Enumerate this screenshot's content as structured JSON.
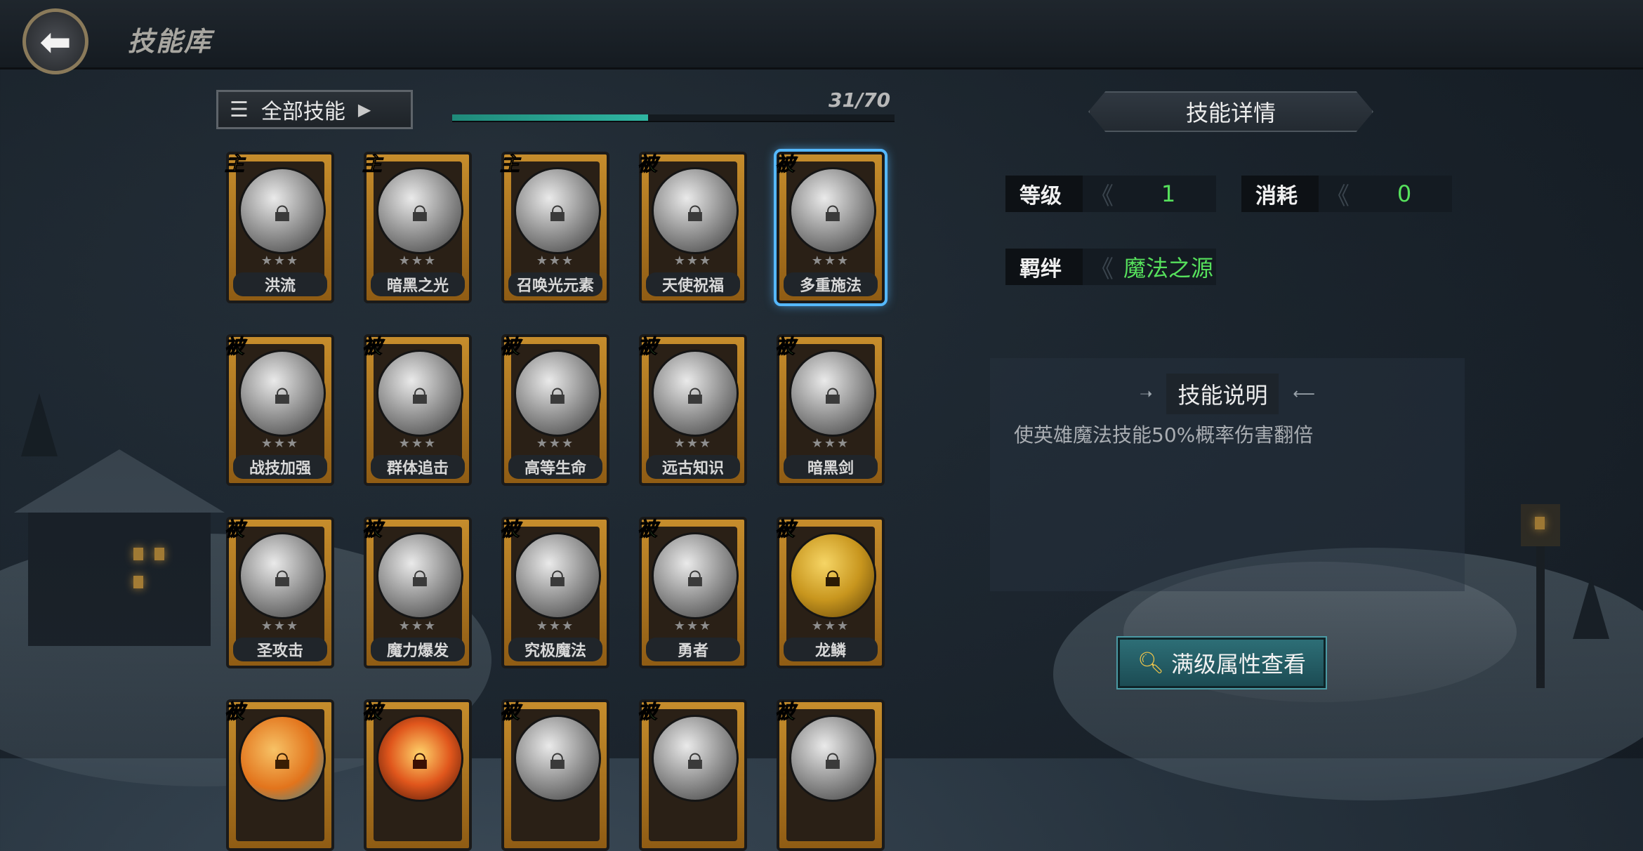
{
  "header": {
    "title": "技能库",
    "back_icon": "back-arrow-icon"
  },
  "filter": {
    "label": "全部技能",
    "progress_text": "31/70",
    "progress_fraction": 0.443
  },
  "skills": [
    {
      "name": "洪流",
      "type": "主",
      "stars": "★★★",
      "icon": "wave-icon"
    },
    {
      "name": "暗黑之光",
      "type": "主",
      "stars": "★★★",
      "icon": "dark-orb-icon"
    },
    {
      "name": "召唤光元素",
      "type": "主",
      "stars": "★★★",
      "icon": "yin-yang-icon"
    },
    {
      "name": "天使祝福",
      "type": "被",
      "stars": "★★★",
      "icon": "rainbow-icon"
    },
    {
      "name": "多重施法",
      "type": "被",
      "stars": "★★★",
      "icon": "hands-icon",
      "selected": true
    },
    {
      "name": "战技加强",
      "type": "被",
      "stars": "★★★",
      "icon": "claw-icon"
    },
    {
      "name": "群体追击",
      "type": "被",
      "stars": "★★★",
      "icon": "tentacle-icon"
    },
    {
      "name": "高等生命",
      "type": "被",
      "stars": "★★★",
      "icon": "chalice-icon"
    },
    {
      "name": "远古知识",
      "type": "被",
      "stars": "★★★",
      "icon": "tome-icon"
    },
    {
      "name": "暗黑剑",
      "type": "被",
      "stars": "★★★",
      "icon": "dark-sword-icon"
    },
    {
      "name": "圣攻击",
      "type": "被",
      "stars": "★★★",
      "icon": "holy-sword-icon"
    },
    {
      "name": "魔力爆发",
      "type": "被",
      "stars": "★★★",
      "icon": "vortex-icon"
    },
    {
      "name": "究极魔法",
      "type": "被",
      "stars": "★★★",
      "icon": "swirl-icon"
    },
    {
      "name": "勇者",
      "type": "被",
      "stars": "★★★",
      "icon": "knight-icon"
    },
    {
      "name": "龙鳞",
      "type": "被",
      "stars": "★★★",
      "icon": "dragon-icon",
      "color": "gold"
    },
    {
      "name": "",
      "type": "被",
      "stars": "",
      "icon": "fruit-icon",
      "color": "orange"
    },
    {
      "name": "",
      "type": "被",
      "stars": "",
      "icon": "fire-book-icon",
      "color": "fire"
    },
    {
      "name": "",
      "type": "被",
      "stars": "",
      "icon": "flask-icon"
    },
    {
      "name": "",
      "type": "被",
      "stars": "",
      "icon": "statue-icon"
    },
    {
      "name": "",
      "type": "被",
      "stars": "",
      "icon": "beast-icon"
    }
  ],
  "detail": {
    "header": "技能详情",
    "level_label": "等级",
    "level_value": "1",
    "cost_label": "消耗",
    "cost_value": "0",
    "bond_label": "羁绊",
    "bond_value": "魔法之源",
    "desc_title": "技能说明",
    "desc_text": "使英雄魔法技能50%概率伤害翻倍",
    "full_button": "满级属性查看"
  },
  "colors": {
    "accent_green": "#56e05c",
    "select_blue": "#55b8ff",
    "card_gold": "#c68d2c",
    "progress": "#2fb6a2"
  }
}
